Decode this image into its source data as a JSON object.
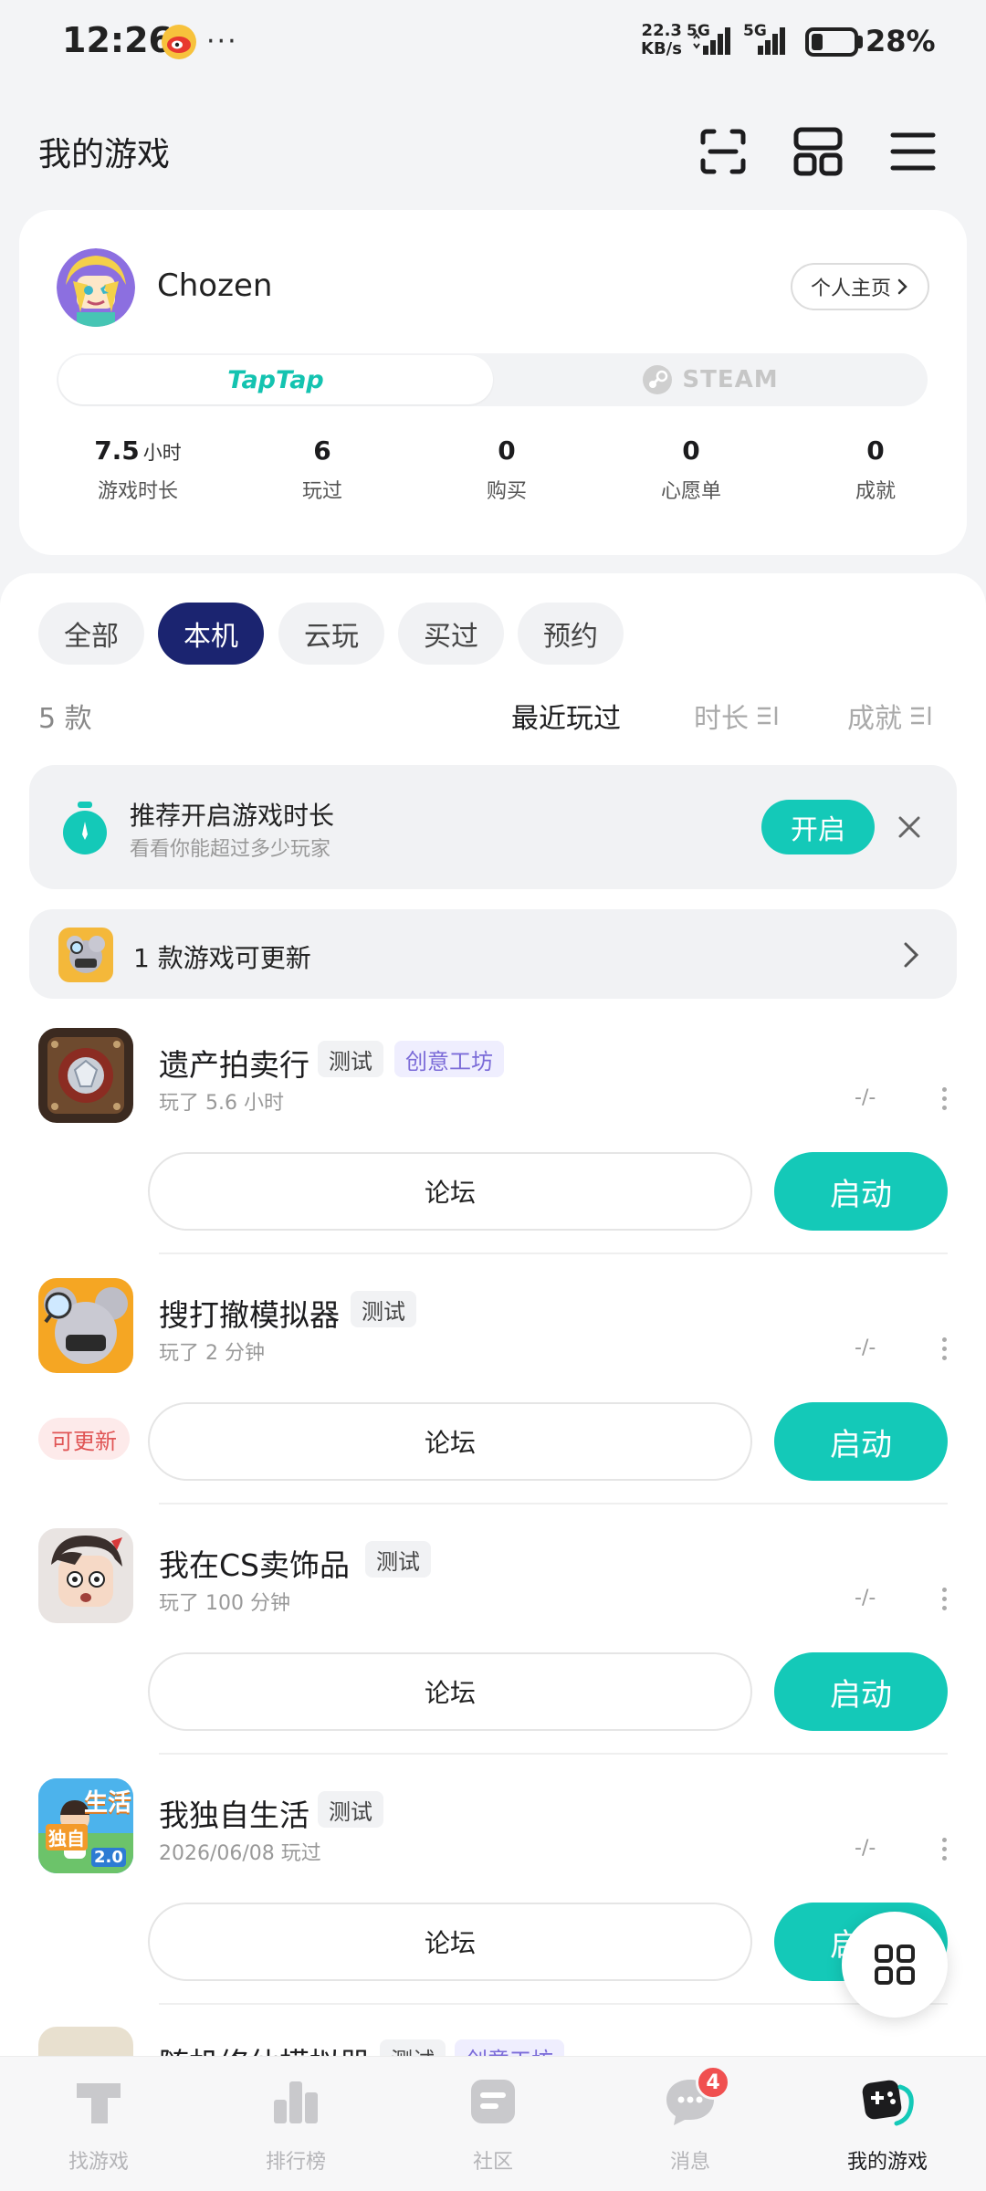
{
  "status_bar": {
    "time": "12:26",
    "more": "···",
    "net_speed_value": "22.3",
    "net_speed_unit": "KB/s",
    "sim1": "5G",
    "sim2": "5G",
    "battery_percent": "28%",
    "battery_level": 0.28
  },
  "header": {
    "title": "我的游戏",
    "icons": [
      "scan-icon",
      "grid-apps-icon",
      "menu-icon"
    ]
  },
  "profile": {
    "username": "Chozen",
    "homepage_label": "个人主页",
    "platforms": {
      "active": "TapTap",
      "inactive": "STEAM"
    },
    "stats": [
      {
        "value": "7.5",
        "unit": "小时",
        "label": "游戏时长"
      },
      {
        "value": "6",
        "unit": "",
        "label": "玩过"
      },
      {
        "value": "0",
        "unit": "",
        "label": "购买"
      },
      {
        "value": "0",
        "unit": "",
        "label": "心愿单"
      },
      {
        "value": "0",
        "unit": "",
        "label": "成就"
      }
    ]
  },
  "filters": {
    "chips": [
      "全部",
      "本机",
      "云玩",
      "买过",
      "预约"
    ],
    "active": "本机"
  },
  "list_meta": {
    "count": "5 款",
    "sort_recent": "最近玩过",
    "sort_duration": "时长",
    "sort_achievement": "成就"
  },
  "banner": {
    "title": "推荐开启游戏时长",
    "subtitle": "看看你能超过多少玩家",
    "button": "开启"
  },
  "update_bar": {
    "text": "1 款游戏可更新"
  },
  "games": [
    {
      "name": "遗产拍卖行",
      "tags": [
        "测试",
        "创意工坊"
      ],
      "sub": "玩了 5.6 小时",
      "dash": "-/-",
      "forum": "论坛",
      "launch": "启动"
    },
    {
      "name": "搜打撤模拟器",
      "tags": [
        "测试"
      ],
      "sub": "玩了 2 分钟",
      "dash": "-/-",
      "forum": "论坛",
      "launch": "启动",
      "update_badge": "可更新"
    },
    {
      "name": "我在CS卖饰品",
      "tags": [
        "测试"
      ],
      "sub": "玩了 100 分钟",
      "dash": "-/-",
      "forum": "论坛",
      "launch": "启动"
    },
    {
      "name": "我独自生活",
      "tags": [
        "测试"
      ],
      "sub": "2026/06/08 玩过",
      "dash": "-/-",
      "forum": "论坛",
      "launch": "启动",
      "icon_text_1": "生活",
      "icon_text_2": "独自",
      "icon_text_3": "2.0"
    },
    {
      "name": "随机修仙模拟器",
      "tags": [
        "测试",
        "创意工坊"
      ]
    }
  ],
  "bottom_nav": {
    "items": [
      "找游戏",
      "排行榜",
      "社区",
      "消息",
      "我的游戏"
    ],
    "active": "我的游戏",
    "message_badge": "4"
  },
  "colors": {
    "accent": "#14c9b8",
    "chip_active": "#1b2470",
    "creative_tag": "#7b6bd8",
    "update_red": "#e05555"
  }
}
